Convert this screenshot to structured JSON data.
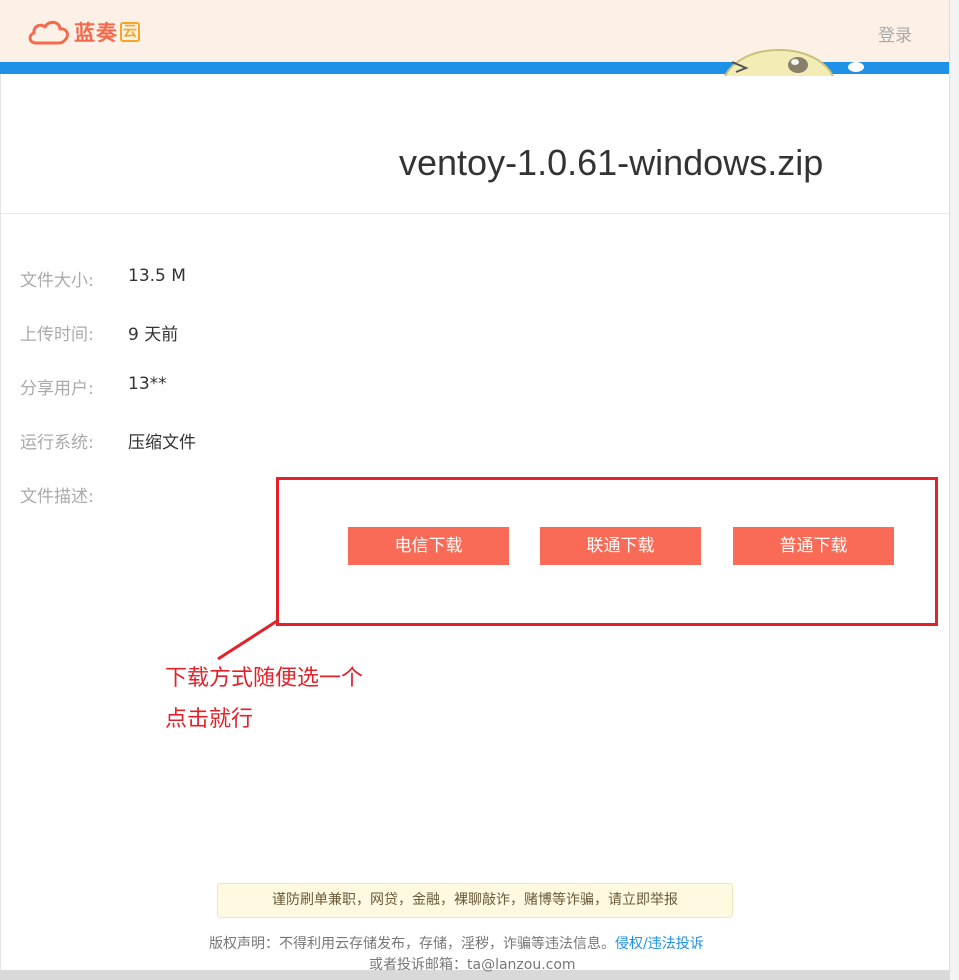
{
  "header": {
    "logo_text": "蓝奏",
    "logo_badge": "云",
    "login_label": "登录"
  },
  "file": {
    "title": "ventoy-1.0.61-windows.zip"
  },
  "info": [
    {
      "label": "文件大小:",
      "value": "13.5 M"
    },
    {
      "label": "上传时间:",
      "value": "9 天前"
    },
    {
      "label": "分享用户:",
      "value": "13**"
    },
    {
      "label": "运行系统:",
      "value": "压缩文件"
    },
    {
      "label": "文件描述:",
      "value": ""
    }
  ],
  "downloads": [
    {
      "label": "电信下载"
    },
    {
      "label": "联通下载"
    },
    {
      "label": "普通下载"
    }
  ],
  "annotation": {
    "line1": "下载方式随便选一个",
    "line2": "点击就行",
    "color": "#e3212a"
  },
  "footer": {
    "notice": "谨防刷单兼职，网贷，金融，裸聊敲诈，赌博等诈骗，请立即举报",
    "copyright": "版权声明：不得利用云存储发布，存储，淫秽，诈骗等违法信息。",
    "report_link": "侵权/违法投诉",
    "contact": "或者投诉邮箱：ta@lanzou.com"
  },
  "colors": {
    "accent": "#f96b56",
    "header_bg": "#fdf0e6",
    "blue_bar": "#1e90e6"
  }
}
